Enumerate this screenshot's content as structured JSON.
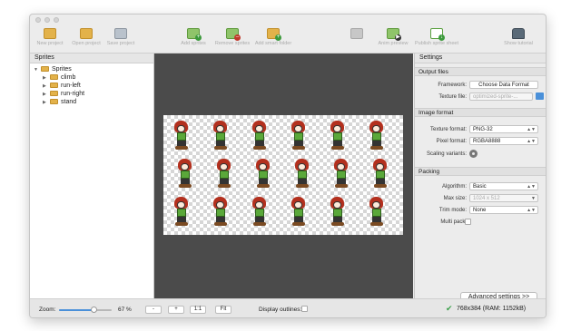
{
  "toolbar": {
    "new_project": "New project",
    "open_project": "Open project",
    "save_project": "Save project",
    "add_sprites": "Add sprites",
    "remove_sprites": "Remove sprites",
    "add_smart_folder": "Add smart folder",
    "anim_preview": "Anim preview",
    "publish": "Publish sprite sheet",
    "show_tutorial": "Show tutorial"
  },
  "sprites_panel": {
    "title": "Sprites",
    "root": "Sprites",
    "folders": [
      "climb",
      "run-left",
      "run-right",
      "stand"
    ]
  },
  "settings": {
    "title": "Settings",
    "output_files": {
      "section": "Output files",
      "framework_label": "Framework:",
      "framework_value": "Choose Data Format",
      "texture_file_label": "Texture file:",
      "texture_file_placeholder": "optimized-sprite-..."
    },
    "image_format": {
      "section": "Image format",
      "texture_format_label": "Texture format:",
      "texture_format_value": "PNG-32",
      "pixel_format_label": "Pixel format:",
      "pixel_format_value": "RGBA8888",
      "scaling_label": "Scaling variants:"
    },
    "packing": {
      "section": "Packing",
      "algorithm_label": "Algorithm:",
      "algorithm_value": "Basic",
      "max_size_label": "Max size:",
      "max_size_value": "1024 x 512",
      "trim_label": "Trim mode:",
      "trim_value": "None",
      "multipack_label": "Multi pack:"
    },
    "advanced_button": "Advanced settings >>"
  },
  "statusbar": {
    "zoom_label": "Zoom:",
    "zoom_value": "67 %",
    "minus": "-",
    "plus": "+",
    "one_to_one": "1:1",
    "fit": "Fit",
    "display_outlines": "Display outlines:",
    "status_text": "768x384 (RAM: 1152kB)"
  },
  "colors": {
    "hair": "#b3301e",
    "shirt": "#5aa83a",
    "canvas_bg": "#4b4b4b",
    "status_ok": "#3aa04a"
  }
}
